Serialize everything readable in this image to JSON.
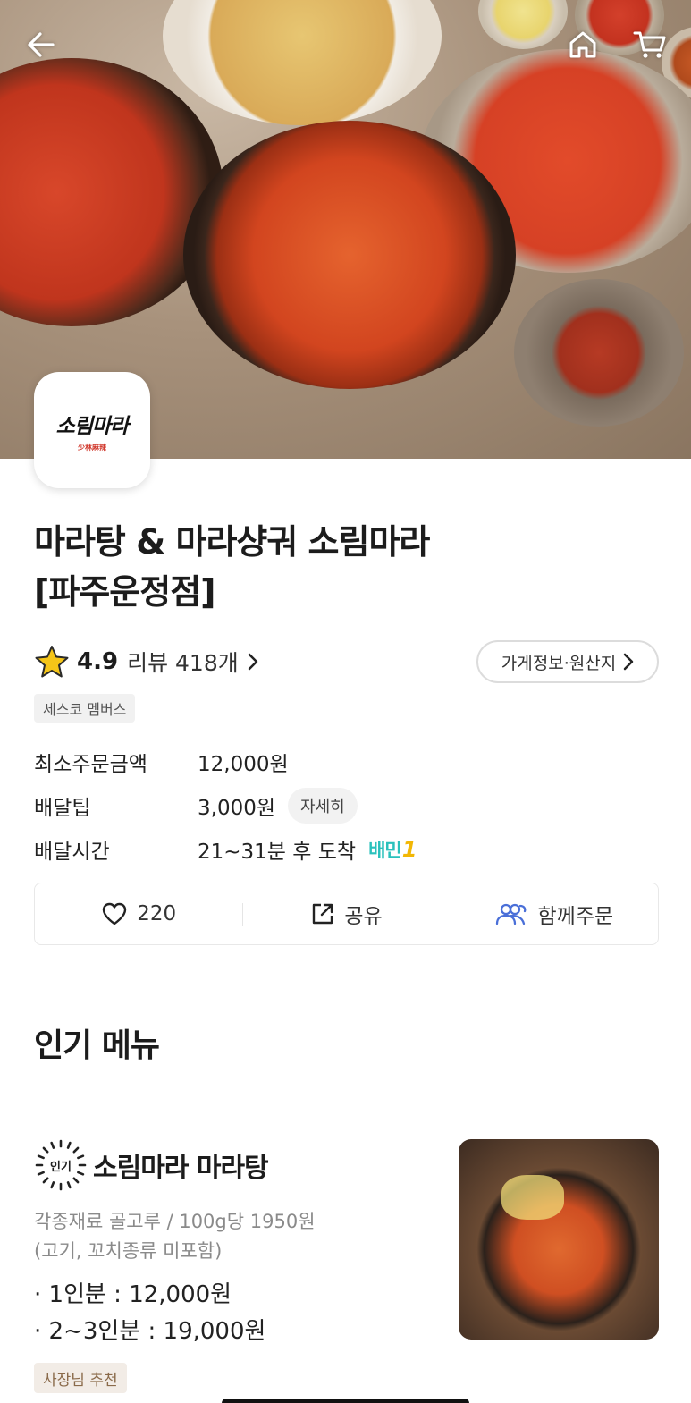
{
  "store": {
    "logo_text": "소림마라",
    "logo_sub": "少林麻辣",
    "name_line1": "마라탕 & 마라샹궈 소림마라",
    "name_line2": "[파주운정점]",
    "rating": "4.9",
    "review_label": "리뷰 418개",
    "info_button": "가게정보·원산지",
    "member_badge": "세스코 멤버스"
  },
  "delivery": {
    "min_order_label": "최소주문금액",
    "min_order_value": "12,000원",
    "tip_label": "배달팁",
    "tip_value": "3,000원",
    "tip_detail": "자세히",
    "time_label": "배달시간",
    "time_value": "21~31분 후 도착",
    "baemin_brand": "배민",
    "baemin_num": "1"
  },
  "actions": {
    "like_count": "220",
    "share_label": "공유",
    "group_order_label": "함께주문"
  },
  "popular": {
    "section_title": "인기 메뉴",
    "items": [
      {
        "badge": "인기",
        "name": "소림마라 마라탕",
        "desc_line1": "각종재료 골고루 / 100g당 1950원",
        "desc_line2": "(고기, 꼬치종류 미포함)",
        "price_line1": "· 1인분 : 12,000원",
        "price_line2": "· 2~3인분 : 19,000원",
        "tag": "사장님 추천"
      }
    ]
  },
  "icons": {
    "back": "arrow-left-icon",
    "home": "home-icon",
    "cart": "cart-icon",
    "star": "star-icon",
    "heart": "heart-icon",
    "share": "share-icon",
    "group": "group-icon"
  },
  "colors": {
    "baemin_mint": "#2ac1bc",
    "star_yellow": "#f5c518",
    "group_blue": "#4a6fd8"
  }
}
